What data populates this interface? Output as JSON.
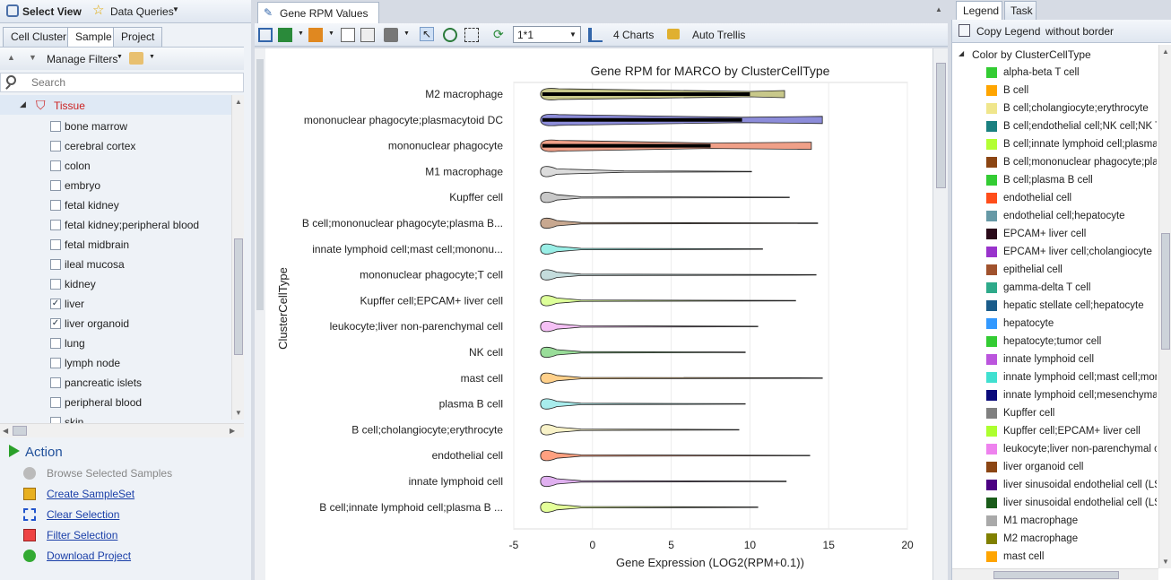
{
  "top": {
    "select_view": "Select View",
    "data_queries": "Data Queries"
  },
  "left_tabs": [
    "Cell Cluster",
    "Sample",
    "Project"
  ],
  "filters": {
    "manage_label": "Manage Filters",
    "search_placeholder": "Search",
    "group_label": "Tissue"
  },
  "tissues": [
    {
      "label": "bone marrow",
      "checked": false
    },
    {
      "label": "cerebral cortex",
      "checked": false
    },
    {
      "label": "colon",
      "checked": false
    },
    {
      "label": "embryo",
      "checked": false
    },
    {
      "label": "fetal kidney",
      "checked": false
    },
    {
      "label": "fetal kidney;peripheral blood",
      "checked": false
    },
    {
      "label": "fetal midbrain",
      "checked": false
    },
    {
      "label": "ileal mucosa",
      "checked": false
    },
    {
      "label": "kidney",
      "checked": false
    },
    {
      "label": "liver",
      "checked": true
    },
    {
      "label": "liver organoid",
      "checked": true
    },
    {
      "label": "lung",
      "checked": false
    },
    {
      "label": "lymph node",
      "checked": false
    },
    {
      "label": "pancreatic islets",
      "checked": false
    },
    {
      "label": "peripheral blood",
      "checked": false
    },
    {
      "label": "skin",
      "checked": false
    }
  ],
  "action": {
    "title": "Action",
    "items": [
      "Browse Selected Samples",
      "Create SampleSet",
      "Clear Selection",
      "Filter Selection",
      "Download Project"
    ]
  },
  "center": {
    "tab_label": "Gene RPM Values",
    "trellis_value": "1*1",
    "charts_label": "4 Charts",
    "auto_trellis": "Auto Trellis"
  },
  "right_tabs": [
    "Legend",
    "Task"
  ],
  "legend": {
    "copy_label": "Copy Legend",
    "without_border": "without border",
    "color_by": "Color by ClusterCellType",
    "items": [
      {
        "label": "alpha-beta T cell",
        "color": "#33cc33"
      },
      {
        "label": "B cell",
        "color": "#ffa500"
      },
      {
        "label": "B cell;cholangiocyte;erythrocyte",
        "color": "#f0e68c"
      },
      {
        "label": "B cell;endothelial cell;NK cell;NK T cell",
        "color": "#1a8080"
      },
      {
        "label": "B cell;innate lymphoid cell;plasma B cell",
        "color": "#b3ff33"
      },
      {
        "label": "B cell;mononuclear phagocyte;plasma B cell",
        "color": "#8b4513"
      },
      {
        "label": "B cell;plasma B cell",
        "color": "#33cc33"
      },
      {
        "label": "endothelial cell",
        "color": "#ff4d1a"
      },
      {
        "label": "endothelial cell;hepatocyte",
        "color": "#6699a6"
      },
      {
        "label": "EPCAM+ liver cell",
        "color": "#2a0a1a"
      },
      {
        "label": "EPCAM+ liver cell;cholangiocyte",
        "color": "#9933cc"
      },
      {
        "label": "epithelial cell",
        "color": "#a0522d"
      },
      {
        "label": "gamma-delta T cell",
        "color": "#2eaa8a"
      },
      {
        "label": "hepatic stellate cell;hepatocyte",
        "color": "#1a5c8a"
      },
      {
        "label": "hepatocyte",
        "color": "#3399ff"
      },
      {
        "label": "hepatocyte;tumor cell",
        "color": "#33cc33"
      },
      {
        "label": "innate lymphoid cell",
        "color": "#bb55dd"
      },
      {
        "label": "innate lymphoid cell;mast cell;mononuclear phagocyte",
        "color": "#40e0d0"
      },
      {
        "label": "innate lymphoid cell;mesenchymal cell",
        "color": "#0a0a7a"
      },
      {
        "label": "Kupffer cell",
        "color": "#808080"
      },
      {
        "label": "Kupffer cell;EPCAM+ liver cell",
        "color": "#adff2f"
      },
      {
        "label": "leukocyte;liver non-parenchymal cell",
        "color": "#ee82ee"
      },
      {
        "label": "liver organoid cell",
        "color": "#8b4513"
      },
      {
        "label": "liver sinusoidal endothelial cell (LSEC)",
        "color": "#4b0082"
      },
      {
        "label": "liver sinusoidal endothelial cell (LSEC)",
        "color": "#1a5c1a"
      },
      {
        "label": "M1 macrophage",
        "color": "#a9a9a9"
      },
      {
        "label": "M2 macrophage",
        "color": "#808000"
      },
      {
        "label": "mast cell",
        "color": "#ffa500"
      }
    ]
  },
  "chart_data": {
    "type": "violin",
    "title": "Gene RPM for MARCO by ClusterCellType",
    "xlabel": "Gene Expression (LOG2(RPM+0.1))",
    "ylabel": "ClusterCellType",
    "xlim": [
      -5,
      20
    ],
    "xticks": [
      -5,
      0,
      5,
      10,
      15,
      20
    ],
    "series": [
      {
        "name": "M2 macrophage",
        "min": -3.3,
        "max": 12.2,
        "fill": "#c8c88a",
        "bulk_to": 10,
        "thick": true
      },
      {
        "name": "mononuclear phagocyte;plasmacytoid DC",
        "min": -3.3,
        "max": 14.6,
        "fill": "#8c8cd9",
        "bulk_to": 9.5,
        "thick": true
      },
      {
        "name": "mononuclear phagocyte",
        "min": -3.3,
        "max": 13.9,
        "fill": "#f0a088",
        "bulk_to": 7.5,
        "thick": true
      },
      {
        "name": "M1 macrophage",
        "min": -3.3,
        "max": 10.1,
        "fill": "#dcdcdc",
        "bulk_to": 2,
        "thick": false
      },
      {
        "name": "Kupffer cell",
        "min": -3.3,
        "max": 12.5,
        "fill": "#c8c8c8",
        "bulk_to": -1,
        "thick": false
      },
      {
        "name": "B cell;mononuclear phagocyte;plasma B...",
        "min": -3.3,
        "max": 14.3,
        "fill": "#c8a890",
        "bulk_to": -1,
        "thick": false
      },
      {
        "name": "innate lymphoid cell;mast cell;mononu...",
        "min": -3.3,
        "max": 10.8,
        "fill": "#99eee6",
        "bulk_to": -1,
        "thick": false
      },
      {
        "name": "mononuclear phagocyte;T cell",
        "min": -3.3,
        "max": 14.2,
        "fill": "#c4dcdc",
        "bulk_to": -1,
        "thick": false
      },
      {
        "name": "Kupffer cell;EPCAM+ liver cell",
        "min": -3.3,
        "max": 12.9,
        "fill": "#ddff99",
        "bulk_to": -1,
        "thick": false
      },
      {
        "name": "leukocyte;liver non-parenchymal cell",
        "min": -3.3,
        "max": 10.5,
        "fill": "#f5c0f5",
        "bulk_to": -1,
        "thick": false
      },
      {
        "name": "NK cell",
        "min": -3.3,
        "max": 9.7,
        "fill": "#99dd99",
        "bulk_to": -1,
        "thick": false
      },
      {
        "name": "mast cell",
        "min": -3.3,
        "max": 14.6,
        "fill": "#ffd08a",
        "bulk_to": -1,
        "thick": false
      },
      {
        "name": "plasma B cell",
        "min": -3.3,
        "max": 9.7,
        "fill": "#a8ecec",
        "bulk_to": -1,
        "thick": false
      },
      {
        "name": "B cell;cholangiocyte;erythrocyte",
        "min": -3.3,
        "max": 9.3,
        "fill": "#f8f2c8",
        "bulk_to": -1,
        "thick": false
      },
      {
        "name": "endothelial cell",
        "min": -3.3,
        "max": 13.8,
        "fill": "#ffa080",
        "bulk_to": -1,
        "thick": false
      },
      {
        "name": "innate lymphoid cell",
        "min": -3.3,
        "max": 12.3,
        "fill": "#e0b0f0",
        "bulk_to": -1,
        "thick": false
      },
      {
        "name": "B cell;innate lymphoid cell;plasma B ...",
        "min": -3.3,
        "max": 10.5,
        "fill": "#e4ff99",
        "bulk_to": -1,
        "thick": false
      }
    ]
  }
}
